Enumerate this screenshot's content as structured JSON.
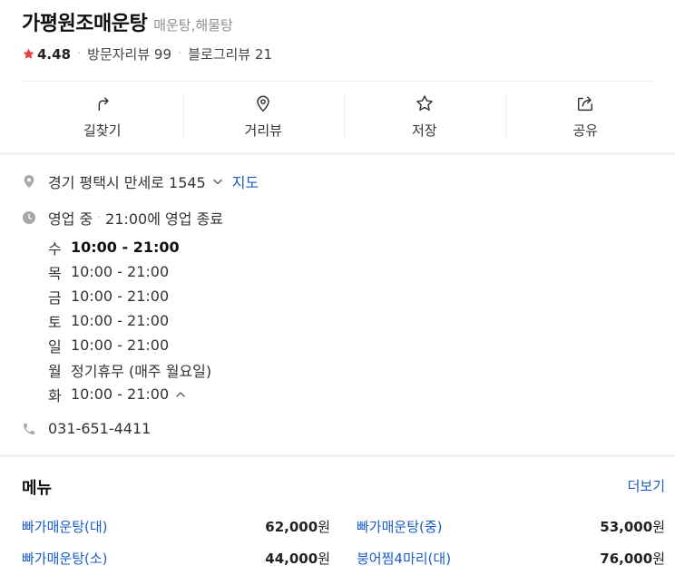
{
  "place": {
    "name": "가평원조매운탕",
    "category": "매운탕,해물탕",
    "rating": "4.48",
    "visitor_reviews": "방문자리뷰 99",
    "blog_reviews": "블로그리뷰 21"
  },
  "actions": [
    {
      "label": "길찾기",
      "icon": "directions-icon"
    },
    {
      "label": "거리뷰",
      "icon": "street-view-icon"
    },
    {
      "label": "저장",
      "icon": "star-outline-icon"
    },
    {
      "label": "공유",
      "icon": "share-icon"
    }
  ],
  "address": {
    "text": "경기 평택시 만세로 1545",
    "map_link": "지도"
  },
  "business": {
    "status": "영업 중",
    "closing": "21:00에 영업 종료"
  },
  "hours": [
    {
      "day": "수",
      "time": "10:00 - 21:00"
    },
    {
      "day": "목",
      "time": "10:00 - 21:00"
    },
    {
      "day": "금",
      "time": "10:00 - 21:00"
    },
    {
      "day": "토",
      "time": "10:00 - 21:00"
    },
    {
      "day": "일",
      "time": "10:00 - 21:00"
    },
    {
      "day": "월",
      "time": "정기휴무 (매주 월요일)"
    },
    {
      "day": "화",
      "time": "10:00 - 21:00"
    }
  ],
  "phone": "031-651-4411",
  "menu": {
    "title": "메뉴",
    "more": "더보기",
    "items": [
      {
        "name": "빠가매운탕(대)",
        "price": "62,000",
        "unit": "원"
      },
      {
        "name": "빠가매운탕(중)",
        "price": "53,000",
        "unit": "원"
      },
      {
        "name": "빠가매운탕(소)",
        "price": "44,000",
        "unit": "원"
      },
      {
        "name": "붕어찜4마리(대)",
        "price": "76,000",
        "unit": "원"
      }
    ]
  },
  "colors": {
    "star": "#e8403c",
    "link": "#1a5dc8",
    "icon_gray": "#a0a0a0"
  }
}
